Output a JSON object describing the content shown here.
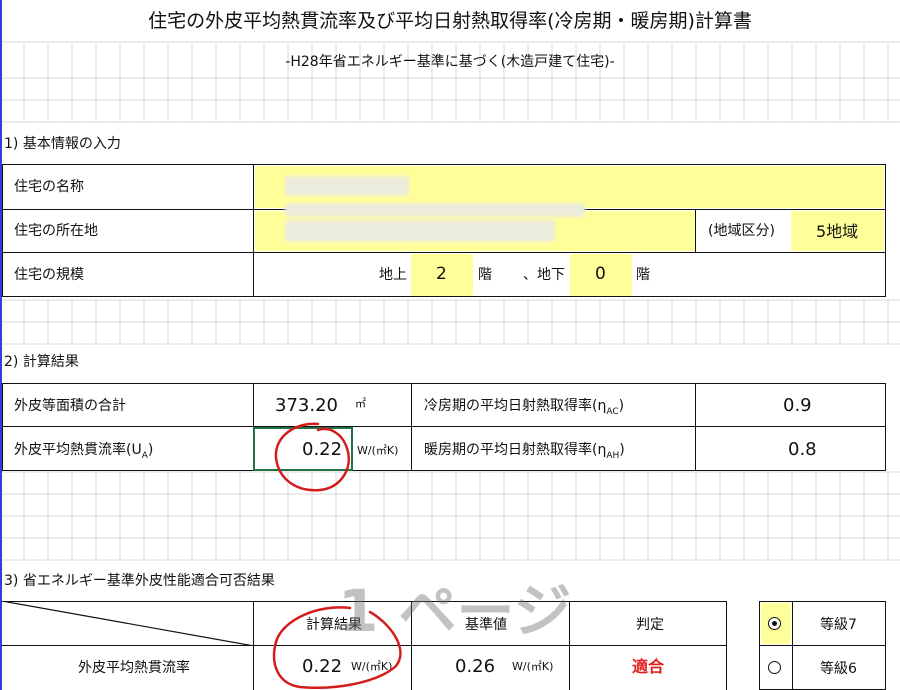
{
  "title": "住宅の外皮平均熱貫流率及び平均日射熱取得率(冷房期・暖房期)計算書",
  "subtitle": "-H28年省エネルギー基準に基づく(木造戸建て住宅)-",
  "section1": {
    "heading": "1) 基本情報の入力",
    "name_label": "住宅の名称",
    "location_label": "住宅の所在地",
    "region_label": "(地域区分)",
    "region_value": "5地域",
    "scale_label": "住宅の規模",
    "above_label": "地上",
    "above_value": "2",
    "above_unit": "階",
    "below_label": "、地下",
    "below_value": "0",
    "below_unit": "階"
  },
  "section2": {
    "heading": "2) 計算結果",
    "area_label": "外皮等面積の合計",
    "area_value": "373.20",
    "area_unit": "㎡",
    "ua_label": "外皮平均熱貫流率(U",
    "ua_sub": "A",
    "ua_close": ")",
    "ua_value": "0.22",
    "ua_unit": "W/(㎡K)",
    "eta_ac_label": "冷房期の平均日射熱取得率(η",
    "eta_ac_sub": "AC",
    "eta_ac_close": ")",
    "eta_ac_value": "0.9",
    "eta_ah_label": "暖房期の平均日射熱取得率(η",
    "eta_ah_sub": "AH",
    "eta_ah_close": ")",
    "eta_ah_value": "0.8"
  },
  "section3": {
    "heading": "3) 省エネルギー基準外皮性能適合可否結果",
    "col_calc": "計算結果",
    "col_standard": "基準値",
    "col_judgement": "判定",
    "row_label": "外皮平均熱貫流率",
    "calc_value": "0.22",
    "calc_unit": "W/(㎡K)",
    "standard_value": "0.26",
    "standard_unit": "W/(㎡K)",
    "judgement": "適合",
    "grades": [
      {
        "label": "等級7",
        "selected": true
      },
      {
        "label": "等級6",
        "selected": false
      }
    ]
  },
  "watermark": "1 ページ",
  "colors": {
    "input_fill": "#ffff99",
    "pass_text": "#e0201c",
    "annotation": "#d41c1c",
    "selected_cell": "#217346",
    "page_break": "#3a3adb"
  }
}
